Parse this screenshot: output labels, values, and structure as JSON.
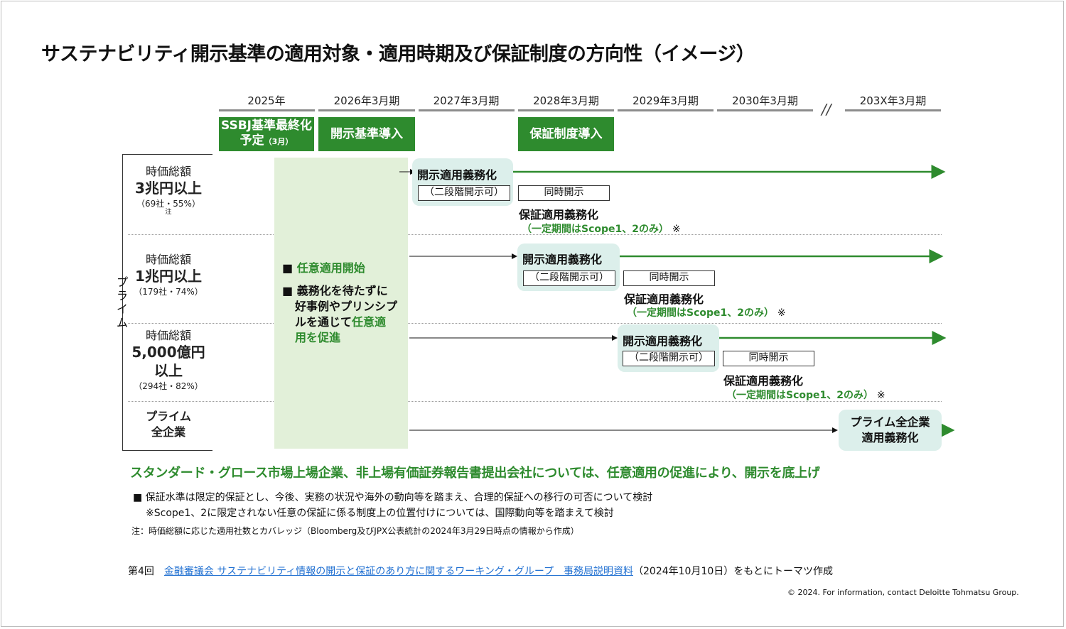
{
  "title": "サステナビリティ開示基準の適用対象・適用時期及び保証制度の方向性（イメージ）",
  "years": [
    "2025年",
    "2026年3月期",
    "2027年3月期",
    "2028年3月期",
    "2029年3月期",
    "2030年3月期",
    "203X年3月期"
  ],
  "break_mark": "//",
  "milestones": {
    "ssbj_line1": "SSBJ基準最終化",
    "ssbj_line2": "予定",
    "ssbj_month": "（3月）",
    "disclosure_intro": "開示基準導入",
    "assurance_intro": "保証制度導入"
  },
  "rows": [
    {
      "l1": "時価総額",
      "l2": "3兆円以上",
      "l3": "（69社・55%）",
      "note": "注"
    },
    {
      "l1": "時価総額",
      "l2": "1兆円以上",
      "l3": "（179社・74%）"
    },
    {
      "l1": "時価総額",
      "l2a": "5,000億円",
      "l2b": "以上",
      "l3": "（294社・82%）"
    },
    {
      "l1": "プライム",
      "l2": "全企業"
    }
  ],
  "prime_label": "プライム",
  "panel": {
    "bullet1_mark": "■",
    "bullet1": "任意適用開始",
    "bullet2_mark": "■",
    "bullet2_a": "義務化を待たずに",
    "bullet2_b": "好事例やプリンシプ",
    "bullet2_c": "ルを通じて",
    "bullet2_green1": "任意適",
    "bullet2_green2": "用を促進"
  },
  "stages": {
    "mandatory": "開示適用義務化",
    "two_stage": "（二段階開示可）",
    "simultaneous": "同時開示",
    "assurance": "保証適用義務化",
    "assurance_sub": "（一定期間はScope1、2のみ）",
    "assurance_mark": "※",
    "prime_all_1": "プライム全企業",
    "prime_all_2": "適用義務化"
  },
  "green_message": "スタンダード・グロース市場上場企業、非上場有価証券報告書提出会社については、任意適用の促進により、開示を底上げ",
  "notes": {
    "n1": "■ 保証水準は限定的保証とし、今後、実務の状況や海外の動向等を踏まえ、合理的保証への移行の可否について検討",
    "n2": "※Scope1、2に限定されない任意の保証に係る制度上の位置付けについては、国際動向等を踏まえて検討",
    "n3": "注：時価総額に応じた適用社数とカバレッジ（Bloomberg及びJPX公表統計の2024年3月29日時点の情報から作成）"
  },
  "source": {
    "prefix": "第4回　",
    "link": "金融審議会 サステナビリティ情報の開示と保証のあり方に関するワーキング・グループ　事務局説明資料",
    "suffix": "（2024年10月10日）をもとにトーマツ作成"
  },
  "copyright": "© 2024. For information, contact Deloitte Tohmatsu Group.",
  "colors": {
    "green": "#2e8b2e",
    "panel": "#e2f0d9",
    "pill": "#dcefeb",
    "link": "#1f6fd1"
  }
}
